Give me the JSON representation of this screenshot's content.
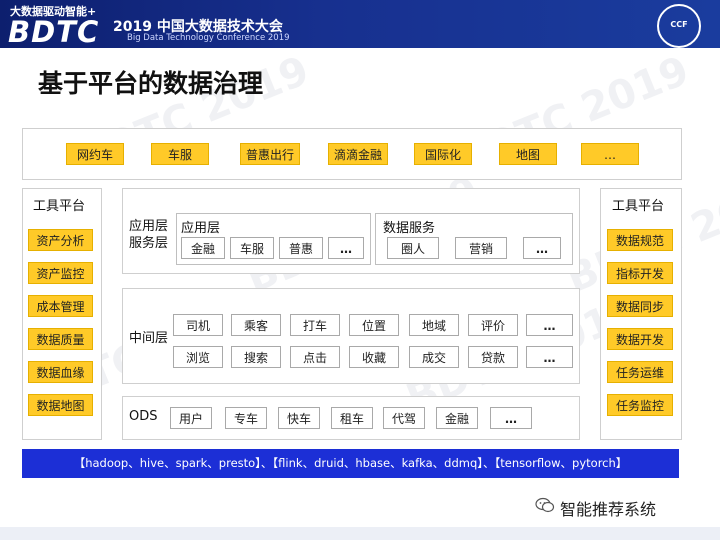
{
  "header": {
    "tagline": "大数据驱动智能+",
    "brand": "BDTC",
    "conf_title": "2019 中国大数据技术大会",
    "conf_subtitle": "Big Data Technology Conference 2019",
    "seal_text": "CCF"
  },
  "watermark": "BDTC 2019",
  "title": "基于平台的数据治理",
  "top_row": [
    "网约车",
    "车服",
    "普惠出行",
    "滴滴金融",
    "国际化",
    "地图",
    "…"
  ],
  "left_tools": {
    "heading": "工具平台",
    "items": [
      "资产分析",
      "资产监控",
      "成本管理",
      "数据质量",
      "数据血缘",
      "数据地图"
    ]
  },
  "right_tools": {
    "heading": "工具平台",
    "items": [
      "数据规范",
      "指标开发",
      "数据同步",
      "数据开发",
      "任务运维",
      "任务监控"
    ]
  },
  "app_layer": {
    "label_line1": "应用层",
    "label_line2": "服务层",
    "app_box": {
      "title": "应用层",
      "items": [
        "金融",
        "车服",
        "普惠",
        "…"
      ]
    },
    "service_box": {
      "title": "数据服务",
      "items": [
        "圈人",
        "营销",
        "…"
      ]
    }
  },
  "middle_layer": {
    "label": "中间层",
    "row1": [
      "司机",
      "乘客",
      "打车",
      "位置",
      "地域",
      "评价",
      "…"
    ],
    "row2": [
      "浏览",
      "搜索",
      "点击",
      "收藏",
      "成交",
      "贷款",
      "…"
    ]
  },
  "ods_layer": {
    "label": "ODS",
    "items": [
      "用户",
      "专车",
      "快车",
      "租车",
      "代驾",
      "金融",
      "…"
    ]
  },
  "footer_bar": "【hadoop、hive、spark、presto】、【flink、druid、hbase、kafka、ddmq】、【tensorflow、pytorch】",
  "wechat_label": "智能推荐系统",
  "colors": {
    "header_blue": "#17308f",
    "tool_yellow": "#ffca28",
    "footer_blue": "#1c2fd6"
  }
}
